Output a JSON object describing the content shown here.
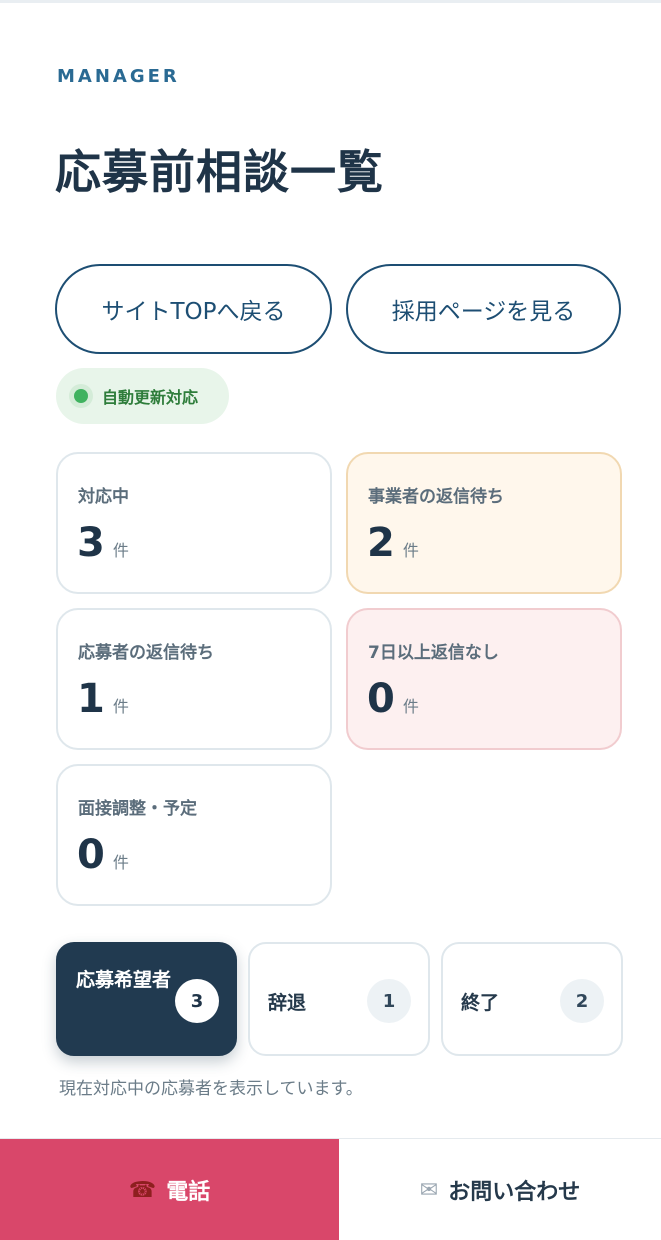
{
  "header": {
    "eyebrow": "MANAGER",
    "title": "応募前相談一覧"
  },
  "actions": {
    "site_top": "サイトTOPへ戻る",
    "recruit_page": "採用ページを見る"
  },
  "live_badge": {
    "label": "自動更新対応",
    "status_color": "#3fb25f"
  },
  "stats": [
    {
      "label": "対応中",
      "value": "3",
      "unit": "件"
    },
    {
      "label": "事業者の返信待ち",
      "value": "2",
      "unit": "件"
    },
    {
      "label": "応募者の返信待ち",
      "value": "1",
      "unit": "件"
    },
    {
      "label": "7日以上返信なし",
      "value": "0",
      "unit": "件"
    },
    {
      "label": "面接調整・予定",
      "value": "0",
      "unit": "件"
    }
  ],
  "tabs": [
    {
      "label": "応募希望者",
      "count": "3",
      "active": true
    },
    {
      "label": "辞退",
      "count": "1",
      "active": false
    },
    {
      "label": "終了",
      "count": "2",
      "active": false
    }
  ],
  "note": "現在対応中の応募者を表示しています。",
  "bottom_bar": {
    "call_label": "電話",
    "call_icon": "telephone-icon",
    "contact_label": "お問い合わせ",
    "contact_icon": "envelope-icon"
  },
  "colors": {
    "accent": "#1d4e73",
    "call": "#d9476a",
    "active_tab": "#213a50"
  }
}
